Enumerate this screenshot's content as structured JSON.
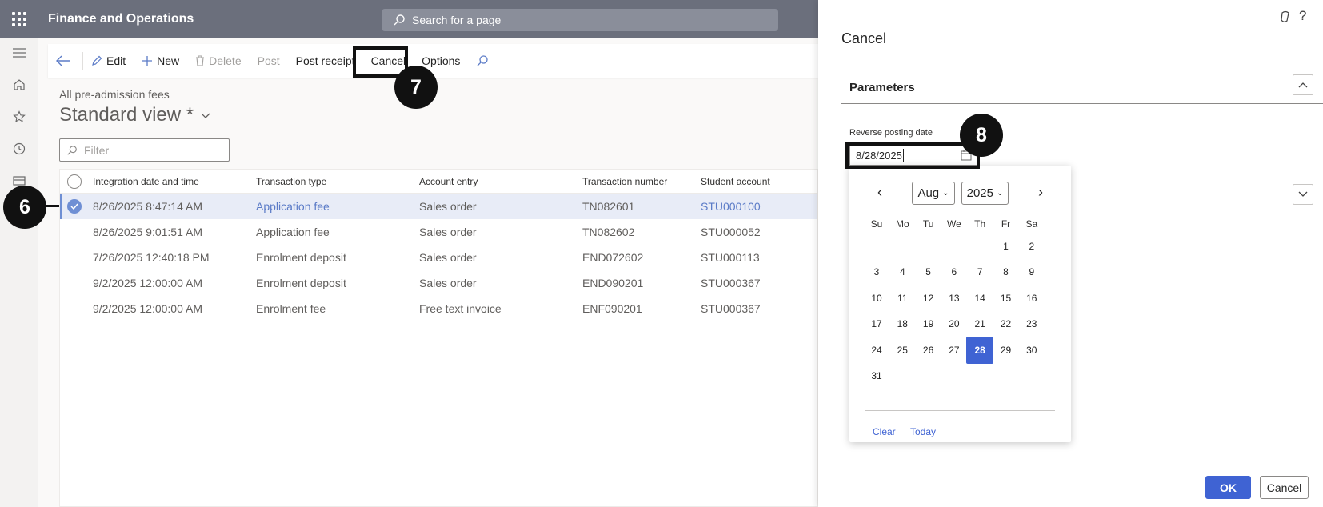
{
  "topbar": {
    "app_title": "Finance and Operations",
    "search_placeholder": "Search for a page"
  },
  "leftnav": {
    "icons": [
      "hamburger-icon",
      "home-icon",
      "star-icon",
      "clock-icon",
      "modules-icon"
    ]
  },
  "actionbar": {
    "edit": "Edit",
    "new": "New",
    "delete": "Delete",
    "post": "Post",
    "post_receipt": "Post receipt",
    "cancel": "Cancel",
    "options": "Options"
  },
  "page": {
    "breadcrumb": "All pre-admission fees",
    "view_title": "Standard view *",
    "filter_placeholder": "Filter"
  },
  "grid": {
    "columns": [
      "Integration date and time",
      "Transaction type",
      "Account entry",
      "Transaction number",
      "Student account"
    ],
    "rows": [
      {
        "date": "8/26/2025 8:47:14 AM",
        "type": "Application fee",
        "entry": "Sales order",
        "number": "TN082601",
        "account": "STU000100",
        "selected": true
      },
      {
        "date": "8/26/2025 9:01:51 AM",
        "type": "Application fee",
        "entry": "Sales order",
        "number": "TN082602",
        "account": "STU000052",
        "selected": false
      },
      {
        "date": "7/26/2025 12:40:18 PM",
        "type": "Enrolment deposit",
        "entry": "Sales order",
        "number": "END072602",
        "account": "STU000113",
        "selected": false
      },
      {
        "date": "9/2/2025 12:00:00 AM",
        "type": "Enrolment deposit",
        "entry": "Sales order",
        "number": "END090201",
        "account": "STU000367",
        "selected": false
      },
      {
        "date": "9/2/2025 12:00:00 AM",
        "type": "Enrolment fee",
        "entry": "Free text invoice",
        "number": "ENF090201",
        "account": "STU000367",
        "selected": false
      }
    ]
  },
  "panel": {
    "title": "Cancel",
    "help_char": "?",
    "section_label": "Parameters",
    "field_label": "Reverse posting date",
    "field_value": "8/28/2025",
    "ok_label": "OK",
    "cancel_label": "Cancel"
  },
  "calendar": {
    "prev": "‹",
    "next": "›",
    "month": "Aug",
    "year": "2025",
    "weekdays": [
      "Su",
      "Mo",
      "Tu",
      "We",
      "Th",
      "Fr",
      "Sa"
    ],
    "first_weekday_index": 5,
    "days_in_month": 31,
    "selected_day": 28,
    "clear": "Clear",
    "today": "Today"
  },
  "callouts": {
    "row_step": "6",
    "cancel_step": "7",
    "date_step": "8"
  },
  "colors": {
    "topbar": "#6b6f7c",
    "accent": "#3f63d3",
    "link": "#5b7bc7",
    "selected_row": "#e8ecf7"
  }
}
